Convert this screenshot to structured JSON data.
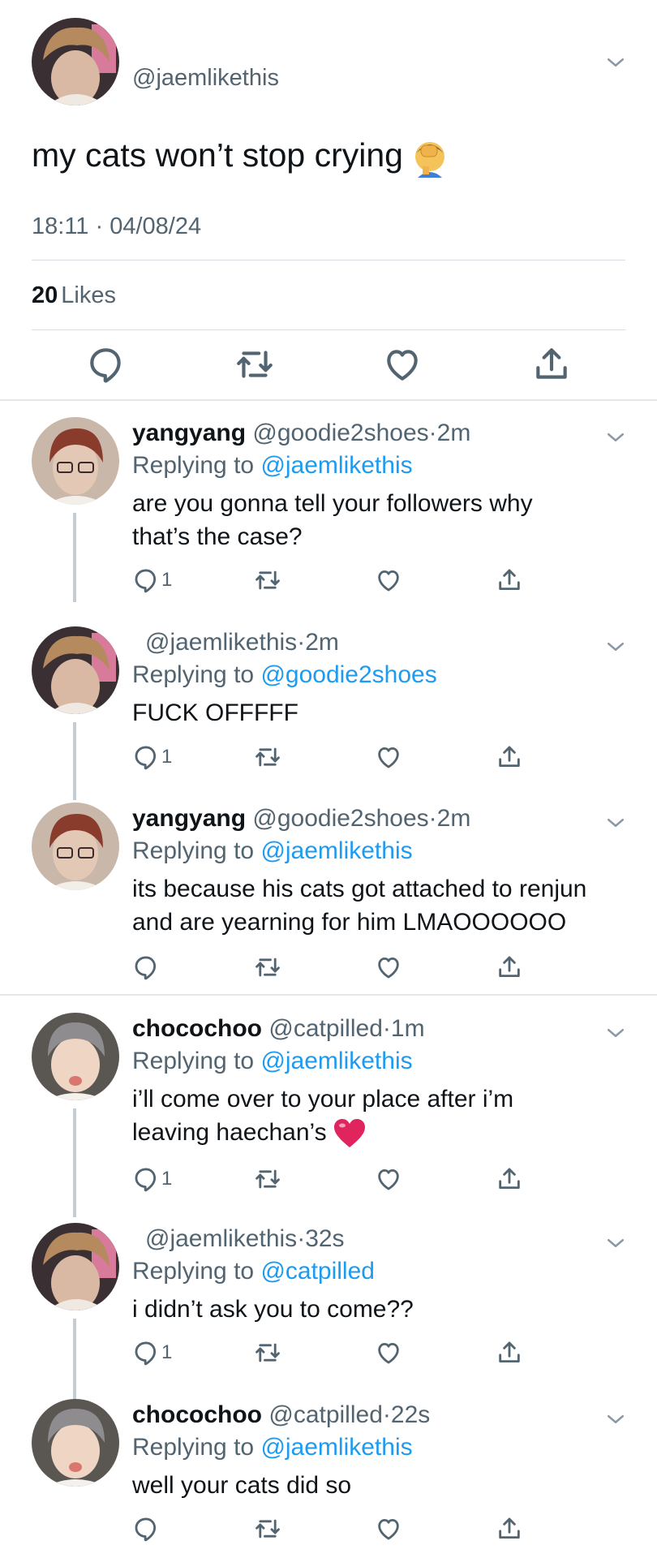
{
  "main_tweet": {
    "handle": "@jaemlikethis",
    "text": "my cats won’t stop crying",
    "emoji": "face-palm-emoji",
    "time": "18:11",
    "dot": "·",
    "date": "04/08/24",
    "likes_count": "20",
    "likes_label": "Likes"
  },
  "replies": [
    {
      "name": "yangyang",
      "handle": "@goodie2shoes",
      "dot": "·",
      "time": "2m",
      "replying_label": "Replying to",
      "replying_to": "@jaemlikethis",
      "lines": [
        "are you gonna tell your followers why",
        "that’s the case?"
      ],
      "reply_count": "1"
    },
    {
      "name": "",
      "handle": "@jaemlikethis",
      "dot": "·",
      "time": "2m",
      "replying_label": "Replying to",
      "replying_to": "@goodie2shoes",
      "lines": [
        "FUCK OFFFFF"
      ],
      "reply_count": "1"
    },
    {
      "name": "yangyang",
      "handle": "@goodie2shoes",
      "dot": "·",
      "time": "2m",
      "replying_label": "Replying to",
      "replying_to": "@jaemlikethis",
      "lines": [
        "its because his cats got attached to renjun",
        "and are yearning for him LMAOOOOOO"
      ],
      "reply_count": ""
    },
    {
      "name": "chocochoo",
      "handle": "@catpilled",
      "dot": "·",
      "time": "1m",
      "replying_label": "Replying to",
      "replying_to": "@jaemlikethis",
      "lines": [
        "i’ll come over to your place after i’m",
        "leaving haechan’s"
      ],
      "reply_count": "1"
    },
    {
      "name": "",
      "handle": "@jaemlikethis",
      "dot": "·",
      "time": "32s",
      "replying_label": "Replying to",
      "replying_to": "@catpilled",
      "lines": [
        "i didn’t ask you to come??"
      ],
      "reply_count": "1"
    },
    {
      "name": "chocochoo",
      "handle": "@catpilled",
      "dot": "·",
      "time": "22s",
      "replying_label": "Replying to",
      "replying_to": "@jaemlikethis",
      "lines": [
        "well your cats did so"
      ],
      "reply_count": ""
    }
  ],
  "colors": {
    "text": "#0f1419",
    "secondary": "#536471",
    "link": "#1d9bf0",
    "heart_emoji": "#e0245e"
  },
  "icons": [
    "chevron-down-icon",
    "reply-icon",
    "retweet-icon",
    "like-icon",
    "share-icon",
    "red-heart-emoji"
  ]
}
